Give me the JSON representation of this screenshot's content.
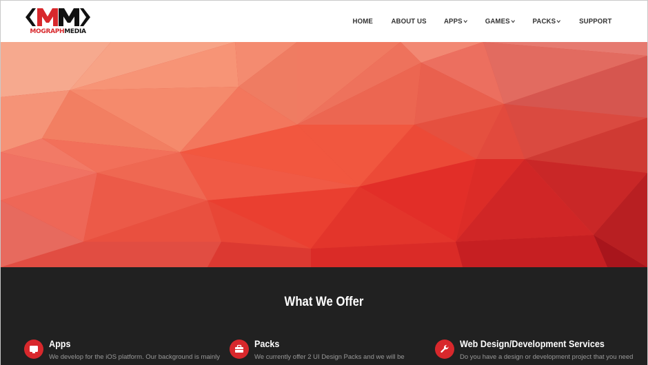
{
  "header": {
    "logo": {
      "text_part1": "MOGRAPH",
      "text_part2": "MEDIA",
      "mark": "MM",
      "brand_red": "#d8282c"
    },
    "nav": [
      {
        "label": "HOME",
        "dropdown": false
      },
      {
        "label": "ABOUT US",
        "dropdown": false
      },
      {
        "label": "APPS",
        "dropdown": true
      },
      {
        "label": "GAMES",
        "dropdown": true
      },
      {
        "label": "PACKS",
        "dropdown": true
      },
      {
        "label": "SUPPORT",
        "dropdown": false
      }
    ]
  },
  "hero": {
    "style": "red low-poly triangle background"
  },
  "offer": {
    "title": "What We Offer",
    "services": [
      {
        "icon": "monitor-icon",
        "title": "Apps",
        "text": "We develop for the iOS platform. Our background is mainly"
      },
      {
        "icon": "briefcase-icon",
        "title": "Packs",
        "text": "We currently offer 2 UI Design Packs and we will be"
      },
      {
        "icon": "wrench-icon",
        "title": "Web Design/Development Services",
        "text": "Do you have a design or development project that you need"
      }
    ]
  },
  "colors": {
    "accent": "#d8282c",
    "dark_section": "#212121",
    "nav_text": "#333333"
  }
}
